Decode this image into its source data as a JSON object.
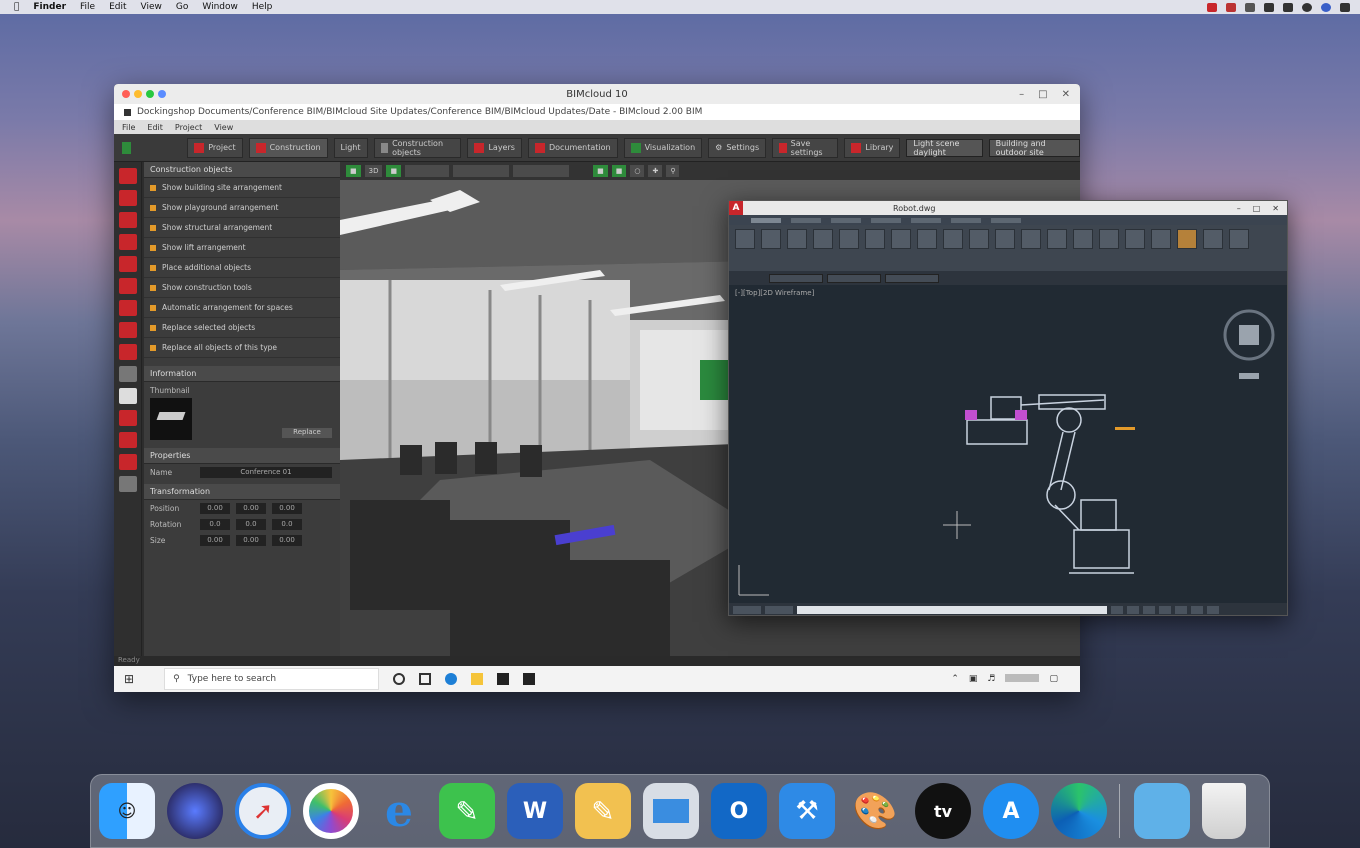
{
  "menubar": {
    "app": "Finder",
    "items": [
      "File",
      "Edit",
      "View",
      "Go",
      "Window",
      "Help"
    ]
  },
  "mainwin": {
    "title": "BIMcloud 10",
    "url": "Dockingshop Documents/Conference BIM/BIMcloud Site Updates/Conference BIM/BIMcloud Updates/Date - BIMcloud 2.00 BIM",
    "menus": [
      "File",
      "Edit",
      "Project",
      "View"
    ],
    "ribbon": [
      "Project",
      "Construction",
      "Light",
      "Construction objects",
      "Layers",
      "Documentation",
      "Visualization",
      "Settings",
      "Save settings",
      "Library"
    ],
    "select1": "Light scene daylight",
    "select2": "Building and outdoor site",
    "panel_title": "Construction objects",
    "panel_items": [
      "Show building site arrangement",
      "Show playground arrangement",
      "Show structural arrangement",
      "Show lift arrangement",
      "Place additional objects",
      "Show construction tools",
      "Automatic arrangement for spaces",
      "Replace selected objects",
      "Replace all objects of this type"
    ],
    "section_title": "Information",
    "subsection": "Thumbnail",
    "btn": "Replace",
    "properties_title": "Properties",
    "name_label": "Name",
    "name_value": "Conference 01",
    "transform_title": "Transformation",
    "pos_label": "Position",
    "rot_label": "Rotation",
    "size_label": "Size",
    "pos": [
      "0.00",
      "0.00",
      "0.00"
    ],
    "rot": [
      "0.0",
      "0.0",
      "0.0"
    ],
    "size": [
      "0.00",
      "0.00",
      "0.00"
    ],
    "status": "Ready",
    "taskbar_search": "Type here to search"
  },
  "cad": {
    "title": "Robot.dwg",
    "tab": "[-][Top][2D Wireframe]"
  },
  "dock": {
    "items": [
      "Finder",
      "Siri",
      "Safari",
      "Photos",
      "Internet Explorer",
      "Pencil",
      "Word",
      "Pages",
      "Parallels",
      "Outlook",
      "Xcode",
      "Paintbrush",
      "tv",
      "App Store",
      "Edge",
      "Folder",
      "Trash"
    ]
  }
}
